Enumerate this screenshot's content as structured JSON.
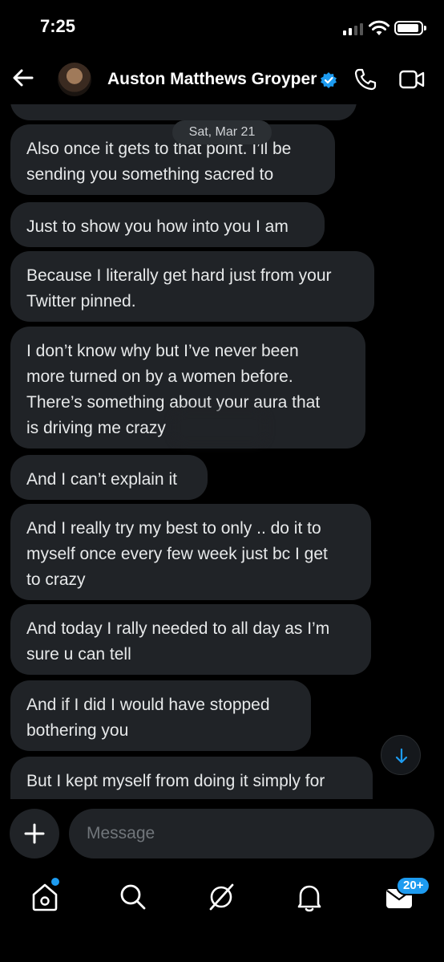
{
  "status_bar": {
    "time": "7:25"
  },
  "header": {
    "contact_name": "Auston Matthews Groyper"
  },
  "date_separator": "Sat, Mar 21",
  "messages": [
    {
      "text": "Also once it gets to that point. I’ll be\nsending you something sacred to"
    },
    {
      "text": "Just to show you how into you I am"
    },
    {
      "text": "Because I literally get hard just from your\nTwitter pinned."
    },
    {
      "text": "I don’t know why but I’ve never been\nmore turned on by a women before.\nThere’s something about your aura that\nis driving me crazy"
    },
    {
      "text": "And I can’t explain it"
    },
    {
      "text": "And I really try my best to only .. do it to\nmyself once every few week just bc I get\nto crazy"
    },
    {
      "text": "And today I rally needed to all day as I’m\nsure u can tell"
    },
    {
      "text": "And if I did I would have stopped\nbothering you"
    },
    {
      "text": "But I kept myself from doing it simply for"
    }
  ],
  "composer": {
    "placeholder": "Message"
  },
  "nav": {
    "messages_badge": "20+"
  },
  "colors": {
    "accent": "#1d9bf0",
    "bubble": "#202327",
    "background": "#000000"
  },
  "icons": [
    "back-arrow-icon",
    "verified-badge-icon",
    "phone-icon",
    "video-camera-icon",
    "arrow-down-icon",
    "plus-icon",
    "home-icon",
    "search-icon",
    "grok-icon",
    "bell-icon",
    "envelope-icon"
  ]
}
